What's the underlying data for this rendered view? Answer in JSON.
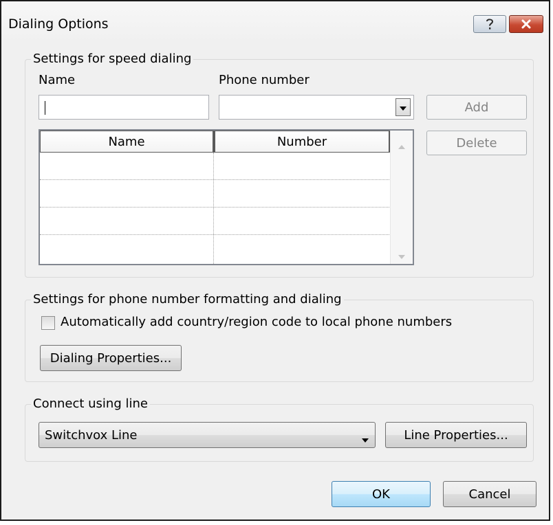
{
  "window": {
    "title": "Dialing Options"
  },
  "titlebar_icons": {
    "help": "help-icon",
    "close": "close-icon"
  },
  "speed_dial": {
    "group_label": "Settings for speed dialing",
    "name_label": "Name",
    "phone_label": "Phone number",
    "name_value": "",
    "phone_value": "",
    "add_label": "Add",
    "delete_label": "Delete",
    "columns": [
      "Name",
      "Number"
    ],
    "rows": [
      [
        "",
        ""
      ],
      [
        "",
        ""
      ],
      [
        "",
        ""
      ],
      [
        "",
        ""
      ]
    ]
  },
  "formatting": {
    "group_label": "Settings for phone number formatting and dialing",
    "checkbox_label": "Automatically add country/region code to local phone numbers",
    "checkbox_checked": false,
    "dialing_properties_label": "Dialing Properties..."
  },
  "connect": {
    "group_label": "Connect using line",
    "selected_line": "Switchvox Line",
    "line_properties_label": "Line Properties..."
  },
  "footer": {
    "ok_label": "OK",
    "cancel_label": "Cancel"
  }
}
